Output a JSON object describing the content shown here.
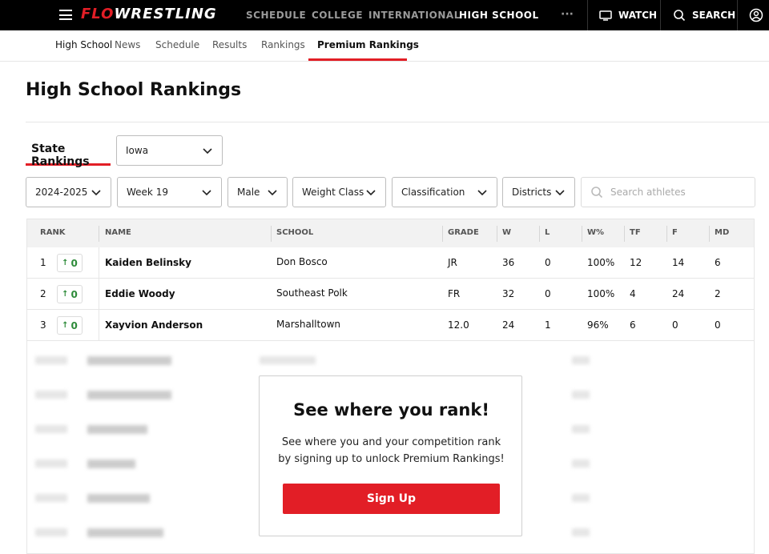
{
  "topbar": {
    "logo_prefix": "FLO",
    "logo_suffix": "WRESTLING",
    "nav": [
      "SCHEDULE",
      "COLLEGE",
      "INTERNATIONAL",
      "HIGH SCHOOL"
    ],
    "active_nav": "HIGH SCHOOL",
    "more_label": "···",
    "watch_label": "WATCH",
    "search_label": "SEARCH"
  },
  "subnav": {
    "brand": "High School",
    "items": [
      "News",
      "Schedule",
      "Results",
      "Rankings",
      "Premium Rankings"
    ],
    "active": "Premium Rankings"
  },
  "page": {
    "title": "High School Rankings",
    "state_tab": "State Rankings"
  },
  "filters": {
    "state": "Iowa",
    "season": "2024-2025",
    "week": "Week 19",
    "gender": "Male",
    "weight_class": "Weight Class",
    "classification": "Classification",
    "districts": "Districts",
    "search_placeholder": "Search athletes"
  },
  "table": {
    "columns": [
      "RANK",
      "NAME",
      "SCHOOL",
      "GRADE",
      "W",
      "L",
      "W%",
      "TF",
      "F",
      "MD"
    ],
    "rows": [
      {
        "rank": "1",
        "trend": "0",
        "name": "Kaiden Belinsky",
        "school": "Don Bosco",
        "grade": "JR",
        "w": "36",
        "l": "0",
        "wpct": "100%",
        "tf": "12",
        "f": "14",
        "md": "6"
      },
      {
        "rank": "2",
        "trend": "0",
        "name": "Eddie Woody",
        "school": "Southeast Polk",
        "grade": "FR",
        "w": "32",
        "l": "0",
        "wpct": "100%",
        "tf": "4",
        "f": "24",
        "md": "2"
      },
      {
        "rank": "3",
        "trend": "0",
        "name": "Xayvion Anderson",
        "school": "Marshalltown",
        "grade": "12.0",
        "w": "24",
        "l": "1",
        "wpct": "96%",
        "tf": "6",
        "f": "0",
        "md": "0"
      }
    ]
  },
  "modal": {
    "title": "See where you rank!",
    "body": "See where you and your competition rank by signing up to unlock Premium Rankings!",
    "button": "Sign Up"
  },
  "colors": {
    "brand_red": "#e21e26",
    "trend_green": "#2e8b3a"
  }
}
